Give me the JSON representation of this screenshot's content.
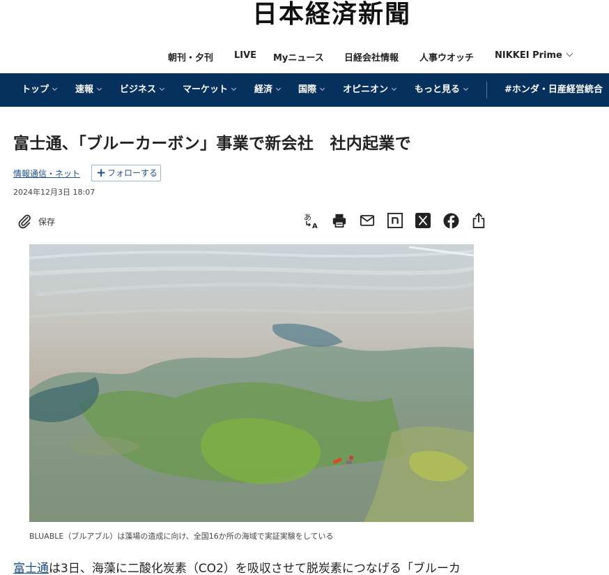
{
  "masthead": {
    "logo_text": "日本経済新聞"
  },
  "topnav": {
    "items": [
      "朝刊・夕刊",
      "LIVE",
      "Myニュース",
      "日経会社情報",
      "人事ウオッチ",
      "NIKKEI Prime"
    ]
  },
  "mainnav": {
    "items": [
      "トップ",
      "速報",
      "ビジネス",
      "マーケット",
      "経済",
      "国際",
      "オピニオン",
      "もっと見る"
    ],
    "hashtag": "#ホンダ・日産経営統合"
  },
  "article": {
    "headline": "富士通、「ブルーカーボン」事業で新会社　社内起業で",
    "category": "情報通信・ネット",
    "follow_label": "フォローする",
    "date": "2024年12月3日 18:07",
    "save_label": "保存",
    "caption": "BLUABLE（ブルアブル）は藻場の造成に向け、全国16か所の海域で実証実験をしている",
    "body_link": "富士通",
    "body_text": "は3日、海藻に二酸化炭素（CO2）を吸収させて脱炭素につなげる「ブルーカ"
  },
  "tools": {
    "icons": [
      "translate-icon",
      "print-icon",
      "mail-icon",
      "note-icon",
      "x-icon",
      "facebook-icon",
      "share-icon"
    ]
  },
  "colors": {
    "nav_bg": "#06315c",
    "link": "#1d4f88"
  }
}
